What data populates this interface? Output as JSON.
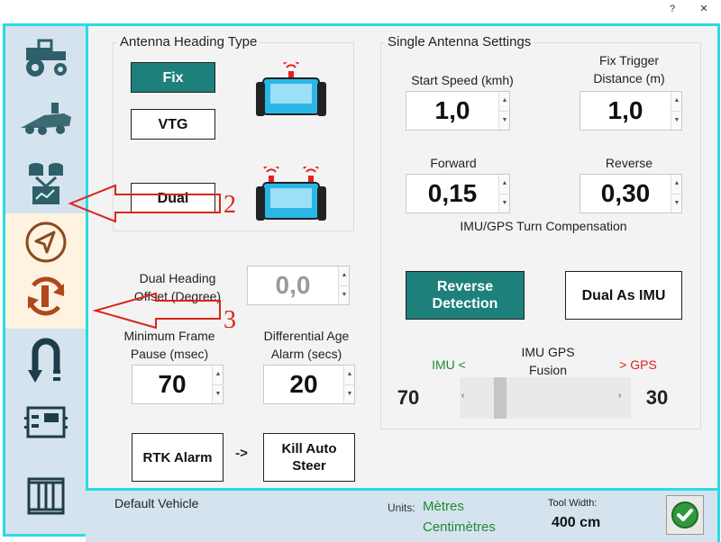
{
  "window": {
    "help_label": "?",
    "close_label": "✕"
  },
  "sidebar": {
    "icons": [
      "tractor-icon",
      "seeder-icon",
      "antenna-config-icon",
      "navigation-arrow-icon",
      "rotate-imu-icon",
      "uturn-icon",
      "hardware-board-icon",
      "tram-lines-icon"
    ],
    "highlight_color": "#fdf3e0"
  },
  "heading": {
    "title": "Antenna Heading Type",
    "fix_label": "Fix",
    "vtg_label": "VTG",
    "dual_label": "Dual"
  },
  "dual_offset": {
    "label": "Dual Heading Offset (Degree)",
    "value": "0,0"
  },
  "frame_pause": {
    "label": "Minimum Frame Pause (msec)",
    "value": "70"
  },
  "diff_age": {
    "label": "Differential Age Alarm (secs)",
    "value": "20"
  },
  "rtk": {
    "alarm_label": "RTK Alarm",
    "arrow": "->",
    "kill_label": "Kill Auto Steer"
  },
  "single": {
    "title": "Single Antenna Settings",
    "start_speed_label": "Start Speed (kmh)",
    "start_speed_value": "1,0",
    "fix_trigger_label": "Fix Trigger Distance (m)",
    "fix_trigger_value": "1,0",
    "forward_label": "Forward",
    "forward_value": "0,15",
    "reverse_label": "Reverse",
    "reverse_value": "0,30",
    "imu_turn_label": "IMU/GPS Turn Compensation",
    "reverse_detection_label": "Reverse Detection",
    "dual_as_imu_label": "Dual As IMU"
  },
  "fusion": {
    "title": "IMU GPS Fusion",
    "imu_label": "IMU <",
    "gps_label": "> GPS",
    "imu_value": "70",
    "gps_value": "30",
    "slider_fraction": 0.7,
    "imu_color": "#1f8a2e",
    "gps_color": "#e0201b"
  },
  "annotations": {
    "label_2": "2",
    "label_3": "3",
    "color": "#d9261c"
  },
  "footer": {
    "vehicle": "Default Vehicle",
    "units_label": "Units:",
    "units_metric": "Mètres",
    "units_small": "Centimètres",
    "tool_width_label": "Tool Width:",
    "tool_width_value": "400 cm"
  },
  "colors": {
    "accent": "#2adbe5",
    "active_button": "#1e807b",
    "sidebar_bg": "#d4e3ee",
    "ok_green": "#2e9a3c"
  }
}
